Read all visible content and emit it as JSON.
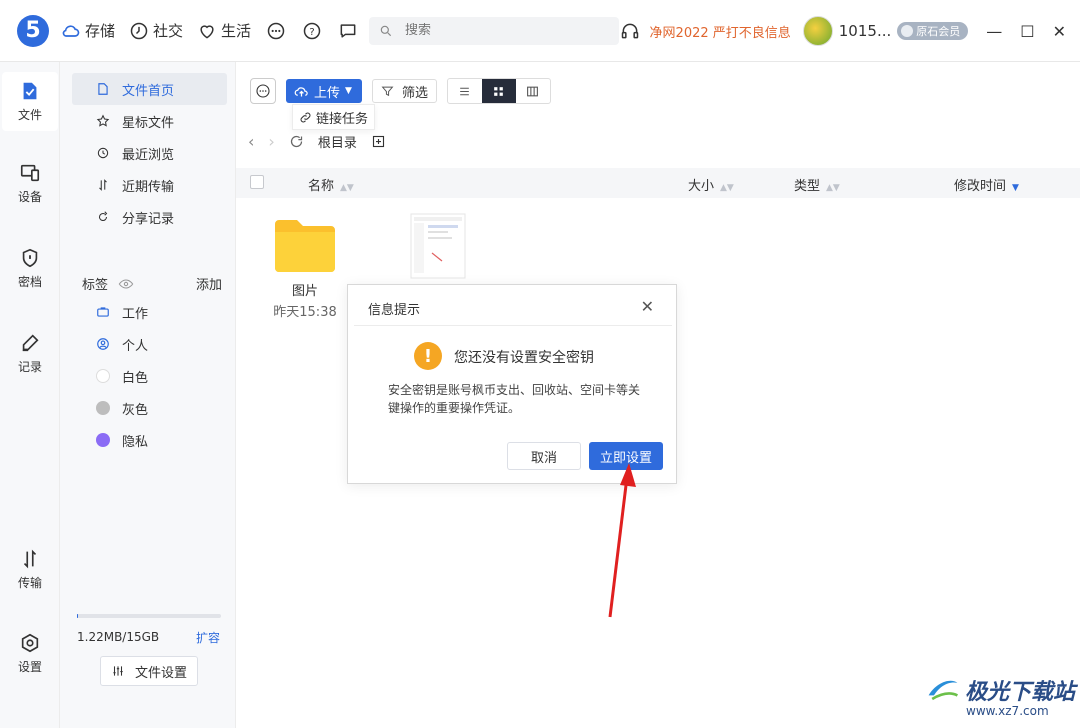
{
  "app": {
    "logo": "5"
  },
  "topnav": [
    {
      "label": "存储",
      "icon": "cloud-icon"
    },
    {
      "label": "社交",
      "icon": "clock-icon"
    },
    {
      "label": "生活",
      "icon": "heart-icon"
    }
  ],
  "search": {
    "placeholder": "搜索"
  },
  "header": {
    "promo": "净网2022 严打不良信息",
    "username": "1015...",
    "member_badge": "原石会员"
  },
  "rail": [
    {
      "label": "文件",
      "icon": "file-icon"
    },
    {
      "label": "设备",
      "icon": "device-icon"
    },
    {
      "label": "密档",
      "icon": "shield-icon"
    },
    {
      "label": "记录",
      "icon": "pen-icon"
    },
    {
      "label": "传输",
      "icon": "transfer-icon"
    },
    {
      "label": "设置",
      "icon": "settings-icon"
    }
  ],
  "sidebar": {
    "items": [
      {
        "label": "文件首页",
        "icon": "file-icon"
      },
      {
        "label": "星标文件",
        "icon": "star-icon"
      },
      {
        "label": "最近浏览",
        "icon": "history-icon"
      },
      {
        "label": "近期传输",
        "icon": "transfer-icon"
      },
      {
        "label": "分享记录",
        "icon": "share-icon"
      }
    ],
    "tags_title": "标签",
    "tags_add": "添加",
    "tags": [
      {
        "label": "工作",
        "color": "#2f6bdc"
      },
      {
        "label": "个人",
        "color": "#2f6bdc"
      },
      {
        "label": "白色",
        "color": "#ffffff"
      },
      {
        "label": "灰色",
        "color": "#bdbdbd"
      },
      {
        "label": "隐私",
        "color": "#8b6cf5"
      }
    ],
    "storage": {
      "used_text": "1.22MB/15GB",
      "used_fraction": 0.0001,
      "expand": "扩容"
    },
    "file_settings": "文件设置"
  },
  "toolbar": {
    "upload": "上传",
    "link_task": "链接任务",
    "filter": "筛选"
  },
  "path": {
    "root": "根目录"
  },
  "table": {
    "headers": {
      "name": "名称",
      "size": "大小",
      "type": "类型",
      "modified": "修改时间"
    }
  },
  "files": [
    {
      "name": "图片",
      "date": "昨天15:38"
    }
  ],
  "dialog": {
    "title": "信息提示",
    "heading": "您还没有设置安全密钥",
    "body": "安全密钥是账号枫币支出、回收站、空间卡等关键操作的重要操作凭证。",
    "cancel": "取消",
    "confirm": "立即设置"
  },
  "watermark": {
    "text": "极光下载站",
    "url": "www.xz7.com"
  },
  "colors": {
    "accent": "#2f6bdc",
    "promo": "#e0652e",
    "warning": "#f5a623",
    "arrow": "#e02020"
  }
}
